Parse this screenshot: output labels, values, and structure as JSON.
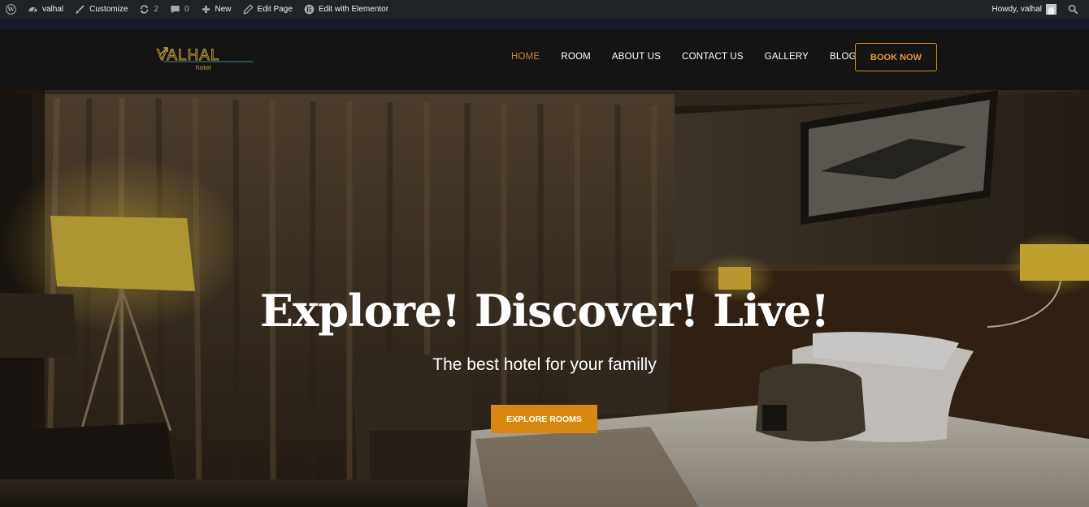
{
  "admin_bar": {
    "site_name": "valhal",
    "customize": "Customize",
    "updates_count": "2",
    "comments_count": "0",
    "new": "New",
    "edit_page": "Edit Page",
    "edit_elementor": "Edit with Elementor",
    "howdy": "Howdy, valhal"
  },
  "logo": {
    "name": "VALHAL",
    "sub": "hotel"
  },
  "nav": {
    "home": "HOME",
    "room": "ROOM",
    "about": "ABOUT US",
    "contact": "CONTACT US",
    "gallery": "GALLERY",
    "blog": "BLOG"
  },
  "book_now": "BOOK NOW",
  "hero": {
    "title": "Explore! Discover! Live!",
    "subtitle": "The best hotel for your familly",
    "button": "EXPLORE ROOMS"
  },
  "colors": {
    "accent": "#d9880f",
    "nav_active": "#c88a2e",
    "header_bg": "#141414",
    "admin_bar_bg": "#1d2327"
  }
}
